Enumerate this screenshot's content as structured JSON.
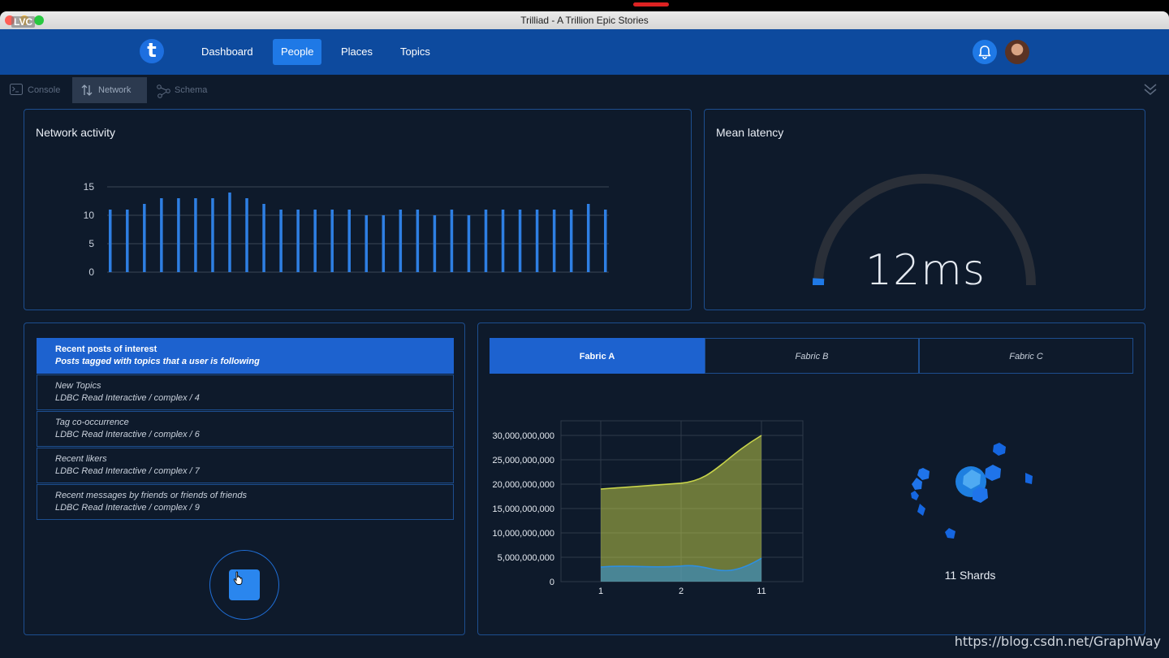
{
  "window": {
    "title": "Trilliad - A Trillion Epic Stories",
    "badge": "LVC"
  },
  "nav": {
    "logo": "t",
    "items": [
      {
        "label": "Dashboard",
        "active": false
      },
      {
        "label": "People",
        "active": true
      },
      {
        "label": "Places",
        "active": false
      },
      {
        "label": "Topics",
        "active": false
      }
    ],
    "icons": [
      "bell-icon",
      "avatar"
    ]
  },
  "toolbar": {
    "tabs": [
      {
        "label": "Console",
        "icon": "terminal-icon",
        "active": false
      },
      {
        "label": "Network",
        "icon": "arrows-up-down-icon",
        "active": true
      },
      {
        "label": "Schema",
        "icon": "graph-nodes-icon",
        "active": false
      }
    ]
  },
  "network": {
    "title": "Network activity",
    "chart_data": {
      "type": "bar",
      "title": "Network activity",
      "ylim": [
        0,
        15
      ],
      "yticks": [
        0,
        5,
        10,
        15
      ],
      "grid": true,
      "values": [
        11,
        11,
        12,
        13,
        13,
        13,
        13,
        14,
        13,
        12,
        11,
        11,
        11,
        11,
        11,
        10,
        10,
        11,
        11,
        10,
        11,
        10,
        11,
        11,
        11,
        11,
        11,
        11,
        12,
        11
      ],
      "color": "#2e7fe3"
    }
  },
  "latency": {
    "title": "Mean latency",
    "value": "12ms",
    "gauge_fraction": 0.02,
    "gauge_color": "#1f79e6",
    "track_color": "#2a2f38"
  },
  "posts": {
    "items": [
      {
        "title": "Recent posts of interest",
        "subtitle": "Posts tagged with topics that a user is following",
        "active": true
      },
      {
        "title": "New Topics",
        "subtitle": "LDBC Read Interactive / complex / 4",
        "active": false
      },
      {
        "title": "Tag co-occurrence",
        "subtitle": "LDBC Read Interactive / complex / 6",
        "active": false
      },
      {
        "title": "Recent likers",
        "subtitle": "LDBC Read Interactive / complex / 7",
        "active": false
      },
      {
        "title": "Recent messages by friends or friends of friends",
        "subtitle": "LDBC Read Interactive / complex / 9",
        "active": false
      }
    ]
  },
  "fabric": {
    "tabs": [
      {
        "label": "Fabric A",
        "active": true
      },
      {
        "label": "Fabric B",
        "active": false
      },
      {
        "label": "Fabric C",
        "active": false
      }
    ],
    "chart_data": {
      "type": "area",
      "categories": [
        "1",
        "2",
        "11"
      ],
      "yticks": [
        0,
        5000000000,
        10000000000,
        15000000000,
        20000000000,
        25000000000,
        30000000000
      ],
      "ylim": [
        0,
        33000000000
      ],
      "grid": true,
      "series": [
        {
          "values": [
            19000000000,
            20200000000,
            30000000000
          ],
          "color": "#c9d54a"
        },
        {
          "values": [
            3000000000,
            3200000000,
            4800000000
          ],
          "color": "#2e8fe0"
        }
      ]
    },
    "shards_label": "11 Shards"
  },
  "watermark": "https://blog.csdn.net/GraphWay"
}
